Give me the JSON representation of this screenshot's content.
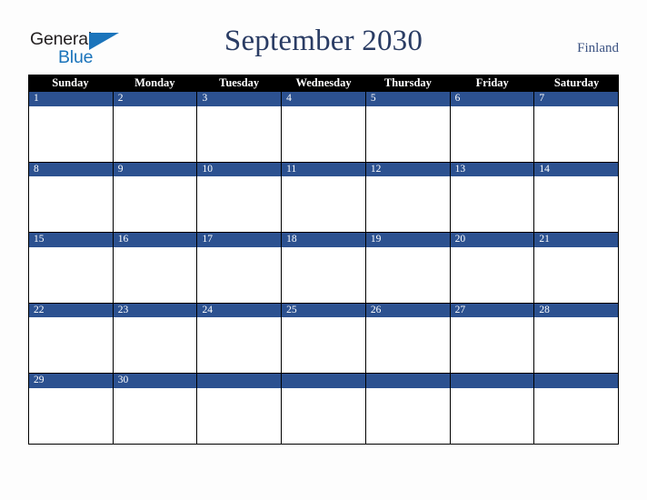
{
  "brand": {
    "line1": "General",
    "line2": "Blue",
    "triangle_color": "#1b74bb",
    "line1_color": "#231f20",
    "line2_color": "#1b74bb"
  },
  "header": {
    "title": "September 2030",
    "country": "Finland",
    "title_color": "#2a3c64",
    "country_color": "#3b5282"
  },
  "calendar": {
    "weekday_headers": [
      "Sunday",
      "Monday",
      "Tuesday",
      "Wednesday",
      "Thursday",
      "Friday",
      "Saturday"
    ],
    "header_bg": "#000000",
    "header_text_color": "#ffffff",
    "day_band_color": "#2c5190",
    "day_number_color": "#ffffff",
    "cell_bg": "#ffffff",
    "grid_line_color": "#000000",
    "weeks": [
      [
        {
          "day": "1",
          "events": []
        },
        {
          "day": "2",
          "events": []
        },
        {
          "day": "3",
          "events": []
        },
        {
          "day": "4",
          "events": []
        },
        {
          "day": "5",
          "events": []
        },
        {
          "day": "6",
          "events": []
        },
        {
          "day": "7",
          "events": []
        }
      ],
      [
        {
          "day": "8",
          "events": []
        },
        {
          "day": "9",
          "events": []
        },
        {
          "day": "10",
          "events": []
        },
        {
          "day": "11",
          "events": []
        },
        {
          "day": "12",
          "events": []
        },
        {
          "day": "13",
          "events": []
        },
        {
          "day": "14",
          "events": []
        }
      ],
      [
        {
          "day": "15",
          "events": []
        },
        {
          "day": "16",
          "events": []
        },
        {
          "day": "17",
          "events": []
        },
        {
          "day": "18",
          "events": []
        },
        {
          "day": "19",
          "events": []
        },
        {
          "day": "20",
          "events": []
        },
        {
          "day": "21",
          "events": []
        }
      ],
      [
        {
          "day": "22",
          "events": []
        },
        {
          "day": "23",
          "events": []
        },
        {
          "day": "24",
          "events": []
        },
        {
          "day": "25",
          "events": []
        },
        {
          "day": "26",
          "events": []
        },
        {
          "day": "27",
          "events": []
        },
        {
          "day": "28",
          "events": []
        }
      ],
      [
        {
          "day": "29",
          "events": []
        },
        {
          "day": "30",
          "events": []
        },
        {
          "day": "",
          "events": []
        },
        {
          "day": "",
          "events": []
        },
        {
          "day": "",
          "events": []
        },
        {
          "day": "",
          "events": []
        },
        {
          "day": "",
          "events": []
        }
      ]
    ]
  }
}
